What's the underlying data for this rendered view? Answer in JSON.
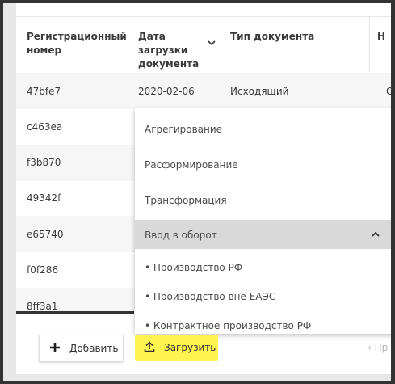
{
  "table": {
    "headers": [
      "Регистрационный номер",
      "Дата загрузки документа",
      "Тип документа",
      "Н"
    ],
    "rows": [
      {
        "id": "47bfe7",
        "date": "2020-02-06",
        "type": "Исходящий",
        "extra": "О"
      },
      {
        "id": "c463ea"
      },
      {
        "id": "f3b870"
      },
      {
        "id": "49342f"
      },
      {
        "id": "e65740"
      },
      {
        "id": "f0f286"
      },
      {
        "id": "8ff3a1"
      }
    ]
  },
  "dropdown": {
    "items": [
      {
        "label": "Агрегирование"
      },
      {
        "label": "Расформирование"
      },
      {
        "label": "Трансформация"
      },
      {
        "label": "Ввод в оборот"
      },
      {
        "label": "• Производство РФ"
      },
      {
        "label": "• Производство вне ЕАЭС"
      },
      {
        "label": "• Контрактное производство РФ"
      }
    ]
  },
  "toolbar": {
    "add_label": "Добавить",
    "upload_label": "Загрузить"
  },
  "pager": {
    "prev_label": "‹ Пр"
  },
  "colors": {
    "upload_button": "#fff44f",
    "active_item": "#d9d9d9",
    "stripe": "#f6f6f6"
  }
}
